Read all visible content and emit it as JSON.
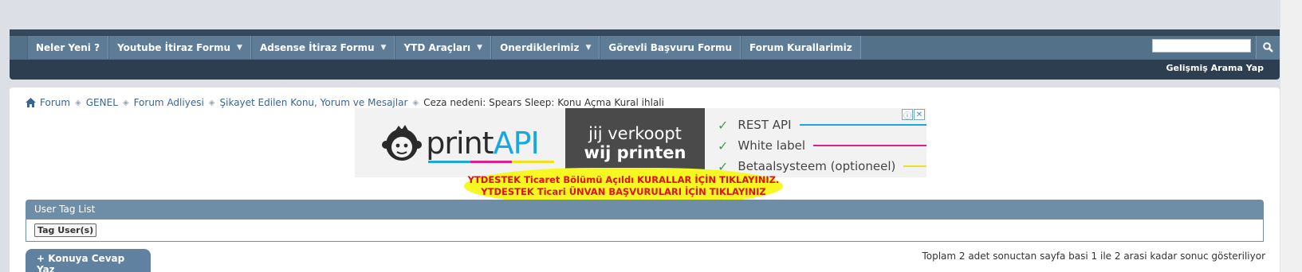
{
  "nav": {
    "tabs": [
      {
        "label": "Neler Yeni ?",
        "dropdown": false
      },
      {
        "label": "Youtube İtiraz Formu",
        "dropdown": true
      },
      {
        "label": "Adsense İtiraz Formu",
        "dropdown": true
      },
      {
        "label": "YTD Araçları",
        "dropdown": true
      },
      {
        "label": "Onerdiklerimiz",
        "dropdown": true
      },
      {
        "label": "Görevli Başvuru Formu",
        "dropdown": false
      },
      {
        "label": "Forum Kurallarimiz",
        "dropdown": false
      }
    ],
    "search_value": "",
    "advanced_search": "Gelişmiş Arama Yap"
  },
  "breadcrumb": {
    "items": [
      "Forum",
      "GENEL",
      "Forum Adliyesi",
      "Şikayet Edilen Konu, Yorum ve Mesajlar"
    ],
    "current": "Ceza nedeni: Spears Sleep: Konu Açma Kural ihlali"
  },
  "ad": {
    "logo_print": "print",
    "logo_api": "API",
    "tagline_1": "jij verkoopt",
    "tagline_2": "wij printen",
    "features": [
      {
        "text": "REST API",
        "color": "#1aa6e0"
      },
      {
        "text": "White label",
        "color": "#e0208a"
      },
      {
        "text": "Betaalsysteem (optioneel)",
        "color": "#f0e020"
      }
    ]
  },
  "promo": {
    "line1": "YTDESTEK Ticaret Bölümü Açıldı KURALLAR İÇİN TIKLAYINIZ.",
    "line2": "YTDESTEK Ticari ÜNVAN BAŞVURULARI İÇİN TIKLAYINIZ"
  },
  "taglist": {
    "title": "User Tag List",
    "button": "Tag User(s)"
  },
  "actions": {
    "reply": "Konuya Cevap Yaz"
  },
  "pager": {
    "info": "Toplam 2 adet sonuctan sayfa basi 1 ile 2 arasi kadar sonuc gösteriliyor"
  },
  "colors": {
    "nav_dark": "#2c3e50",
    "tab": "#5e7c96",
    "link": "#3b6590",
    "promo_bg": "#f7f722",
    "promo_text": "#e01010"
  }
}
